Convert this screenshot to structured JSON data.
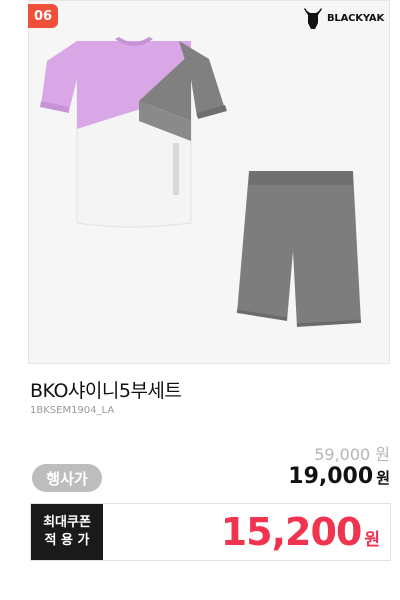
{
  "product": {
    "rank": "06",
    "brand": "BLACKYAK",
    "title": "BKO샤이니5부세트",
    "code": "1BKSEM1904_LA",
    "original_price": "59,000 원",
    "event_label": "행사가",
    "sale_price": "19,000",
    "sale_unit": "원",
    "coupon_line1": "최대쿠폰",
    "coupon_line2": "적 용 가",
    "coupon_price": "15,200",
    "coupon_unit": "원"
  },
  "colors": {
    "badge": "#f0503a",
    "coupon_price": "#f0334f",
    "tshirt_pink": "#d9a6e6",
    "tshirt_gray": "#808080",
    "shorts_gray": "#7d7d7d"
  }
}
